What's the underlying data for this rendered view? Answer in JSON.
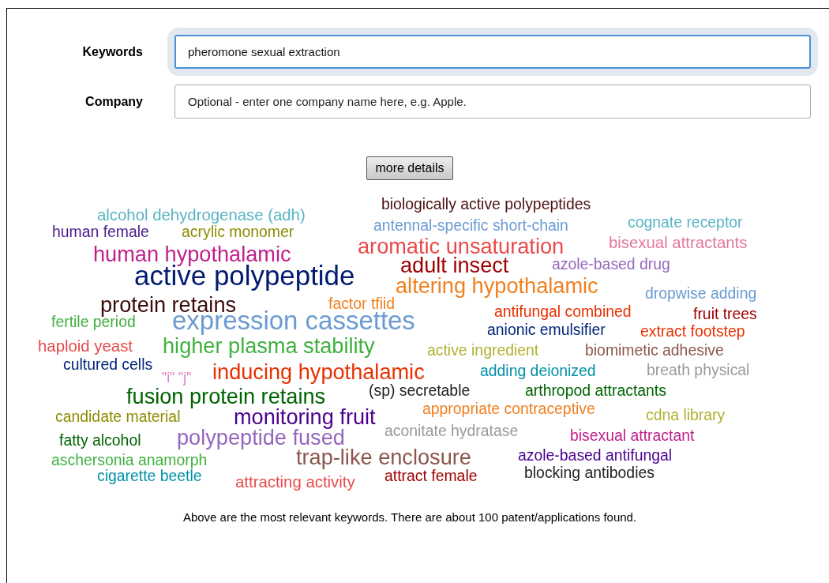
{
  "form": {
    "fields": [
      {
        "label": "Keywords",
        "value": "pheromone sexual extraction ",
        "focused": true
      },
      {
        "label": "Company",
        "placeholder": "Optional - enter one company name here, e.g. Apple.",
        "focused": false
      }
    ],
    "button": "more details"
  },
  "word_cloud": {
    "words": [
      {
        "text": "biologically active polypeptides",
        "color": "#4a1010"
      },
      {
        "text": "alcohol dehydrogenase (adh)",
        "color": "#5ab4c4"
      },
      {
        "text": "antennal-specific short-chain",
        "color": "#6b9bd2"
      },
      {
        "text": "cognate receptor",
        "color": "#5ab4c4"
      },
      {
        "text": "human female",
        "color": "#4b1a8c"
      },
      {
        "text": "acrylic monomer",
        "color": "#8c8c00"
      },
      {
        "text": "human hypothalamic",
        "color": "#c0208c"
      },
      {
        "text": "aromatic unsaturation",
        "color": "#e84a4a"
      },
      {
        "text": "bisexual attractants",
        "color": "#e377a0"
      },
      {
        "text": "active polypeptide",
        "color": "#001a70"
      },
      {
        "text": "adult insect",
        "color": "#a00000"
      },
      {
        "text": "azole-based drug",
        "color": "#9467bd"
      },
      {
        "text": "altering hypothalamic",
        "color": "#f08020"
      },
      {
        "text": "protein retains",
        "color": "#3a0a0a"
      },
      {
        "text": "factor tfiid",
        "color": "#f08020"
      },
      {
        "text": "dropwise adding",
        "color": "#6b9bd2"
      },
      {
        "text": "fertile period",
        "color": "#40b040"
      },
      {
        "text": "expression cassettes",
        "color": "#6b9bd2"
      },
      {
        "text": "antifungal combined",
        "color": "#e83000"
      },
      {
        "text": "fruit trees",
        "color": "#a00000"
      },
      {
        "text": "anionic emulsifier",
        "color": "#00257a"
      },
      {
        "text": "extract footstep",
        "color": "#e83000"
      },
      {
        "text": "haploid yeast",
        "color": "#e84a4a"
      },
      {
        "text": "higher plasma stability",
        "color": "#40b040"
      },
      {
        "text": "active ingredient",
        "color": "#b0b030"
      },
      {
        "text": "biomimetic adhesive",
        "color": "#8c564b"
      },
      {
        "text": "cultured cells",
        "color": "#00257a"
      },
      {
        "text": "\"i\" \"j\"",
        "color": "#e377c2"
      },
      {
        "text": "inducing hypothalamic",
        "color": "#e83000"
      },
      {
        "text": "adding deionized",
        "color": "#0090a8"
      },
      {
        "text": "breath physical",
        "color": "#999999"
      },
      {
        "text": "fusion protein retains",
        "color": "#006400"
      },
      {
        "text": "(sp) secretable",
        "color": "#222222"
      },
      {
        "text": "arthropod attractants",
        "color": "#006400"
      },
      {
        "text": "candidate material",
        "color": "#8c8c00"
      },
      {
        "text": "monitoring fruit",
        "color": "#4b0090"
      },
      {
        "text": "appropriate contraceptive",
        "color": "#f08020"
      },
      {
        "text": "cdna library",
        "color": "#b0b030"
      },
      {
        "text": "fatty alcohol",
        "color": "#006400"
      },
      {
        "text": "polypeptide fused",
        "color": "#9467bd"
      },
      {
        "text": "aconitate hydratase",
        "color": "#999999"
      },
      {
        "text": "bisexual attractant",
        "color": "#c0208c"
      },
      {
        "text": "aschersonia anamorph",
        "color": "#40b040"
      },
      {
        "text": "trap-like enclosure",
        "color": "#8c564b"
      },
      {
        "text": "azole-based antifungal",
        "color": "#4b0090"
      },
      {
        "text": "cigarette beetle",
        "color": "#0090a8"
      },
      {
        "text": "attracting activity",
        "color": "#e84a4a"
      },
      {
        "text": "attract female",
        "color": "#a00000"
      },
      {
        "text": "blocking antibodies",
        "color": "#222222"
      }
    ]
  },
  "footer": "Above are the most relevant keywords. There are about 100 patent/applications found."
}
